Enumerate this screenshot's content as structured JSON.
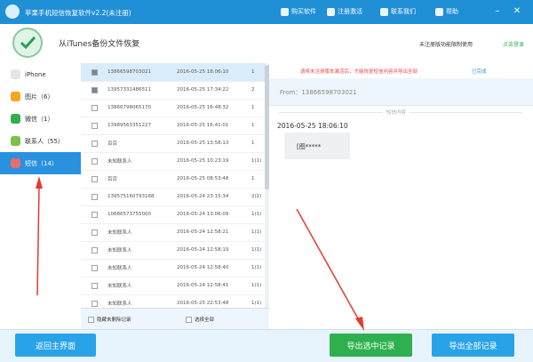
{
  "titlebar": {
    "title": "苹果手机短信恢复软件v2.2(未注册)",
    "menu": [
      {
        "label": "购买软件",
        "icon": "cart-icon"
      },
      {
        "label": "注册激活",
        "icon": "key-icon"
      },
      {
        "label": "联系我们",
        "icon": "mail-icon"
      },
      {
        "label": "帮助",
        "icon": "help-icon"
      }
    ]
  },
  "header": {
    "heading": "从iTunes备份文件恢复",
    "hint": "未注册版功能限制使用",
    "login": "点击登录"
  },
  "sidebar": {
    "device": "iPhone",
    "items": [
      {
        "label": "图片（6）",
        "icon": "photo-icon",
        "color": "#f5a623"
      },
      {
        "label": "微信（1）",
        "icon": "wechat-icon",
        "color": "#2fb04e"
      },
      {
        "label": "联系人（55）",
        "icon": "contacts-icon",
        "color": "#7cc04b"
      },
      {
        "label": "短信（14）",
        "icon": "sms-icon",
        "color": "#e86c6c"
      }
    ]
  },
  "messages": {
    "rows": [
      {
        "who": "13866598703021",
        "when": "2016-05-25 18:06:10",
        "count": "1",
        "selected": true,
        "checked": true
      },
      {
        "who": "13957331486511",
        "when": "2016-05-25 17:34:22",
        "count": "2",
        "selected": false,
        "checked": true
      },
      {
        "who": "13866798065170",
        "when": "2016-05-25 16:48:32",
        "count": "1",
        "selected": false,
        "checked": false
      },
      {
        "who": "13989563351227",
        "when": "2016-05-25 16:41:01",
        "count": "1",
        "selected": false,
        "checked": false
      },
      {
        "who": "百百",
        "when": "2016-05-25 13:58:13",
        "count": "1",
        "selected": false,
        "checked": false
      },
      {
        "who": "未知联系人",
        "when": "2016-05-25 10:23:19",
        "count": "1(1)",
        "selected": false,
        "checked": false
      },
      {
        "who": "百百",
        "when": "2016-05-25 08:53:48",
        "count": "1",
        "selected": false,
        "checked": false
      },
      {
        "who": "13957516079316B",
        "when": "2016-05-24 23:15:34",
        "count": "2(2)",
        "selected": false,
        "checked": false
      },
      {
        "who": "10686573755000",
        "when": "2016-05-24 13:06:09",
        "count": "1(1)",
        "selected": false,
        "checked": false
      },
      {
        "who": "未知联系人",
        "when": "2016-05-24 12:58:21",
        "count": "1(1)",
        "selected": false,
        "checked": false
      },
      {
        "who": "未知联系人",
        "when": "2016-05-24 12:58:19",
        "count": "1(1)",
        "selected": false,
        "checked": false
      },
      {
        "who": "未知联系人",
        "when": "2016-05-24 12:58:40",
        "count": "1(1)",
        "selected": false,
        "checked": false
      },
      {
        "who": "未知联系人",
        "when": "2016-05-24 12:58:41",
        "count": "1(1)",
        "selected": false,
        "checked": false
      },
      {
        "who": "未知联系人",
        "when": "2016-05-25 22:53:48",
        "count": "1(1)",
        "selected": false,
        "checked": false
      }
    ],
    "footer_hide_label": "隐藏未删除记录",
    "footer_selectall_label": "选择全部"
  },
  "detail": {
    "warning": "请将未注册版本激活后，才能恢复短信内容并导出全部",
    "status": "已完成",
    "from": "From：13866598703021",
    "divider_label": "短信内容",
    "msg_time": "2016-05-25 18:06:10",
    "bubble_text": "[图*****"
  },
  "buttons": {
    "back": "返回主界面",
    "export_selected": "导出选中记录",
    "export_all": "导出全部记录"
  }
}
